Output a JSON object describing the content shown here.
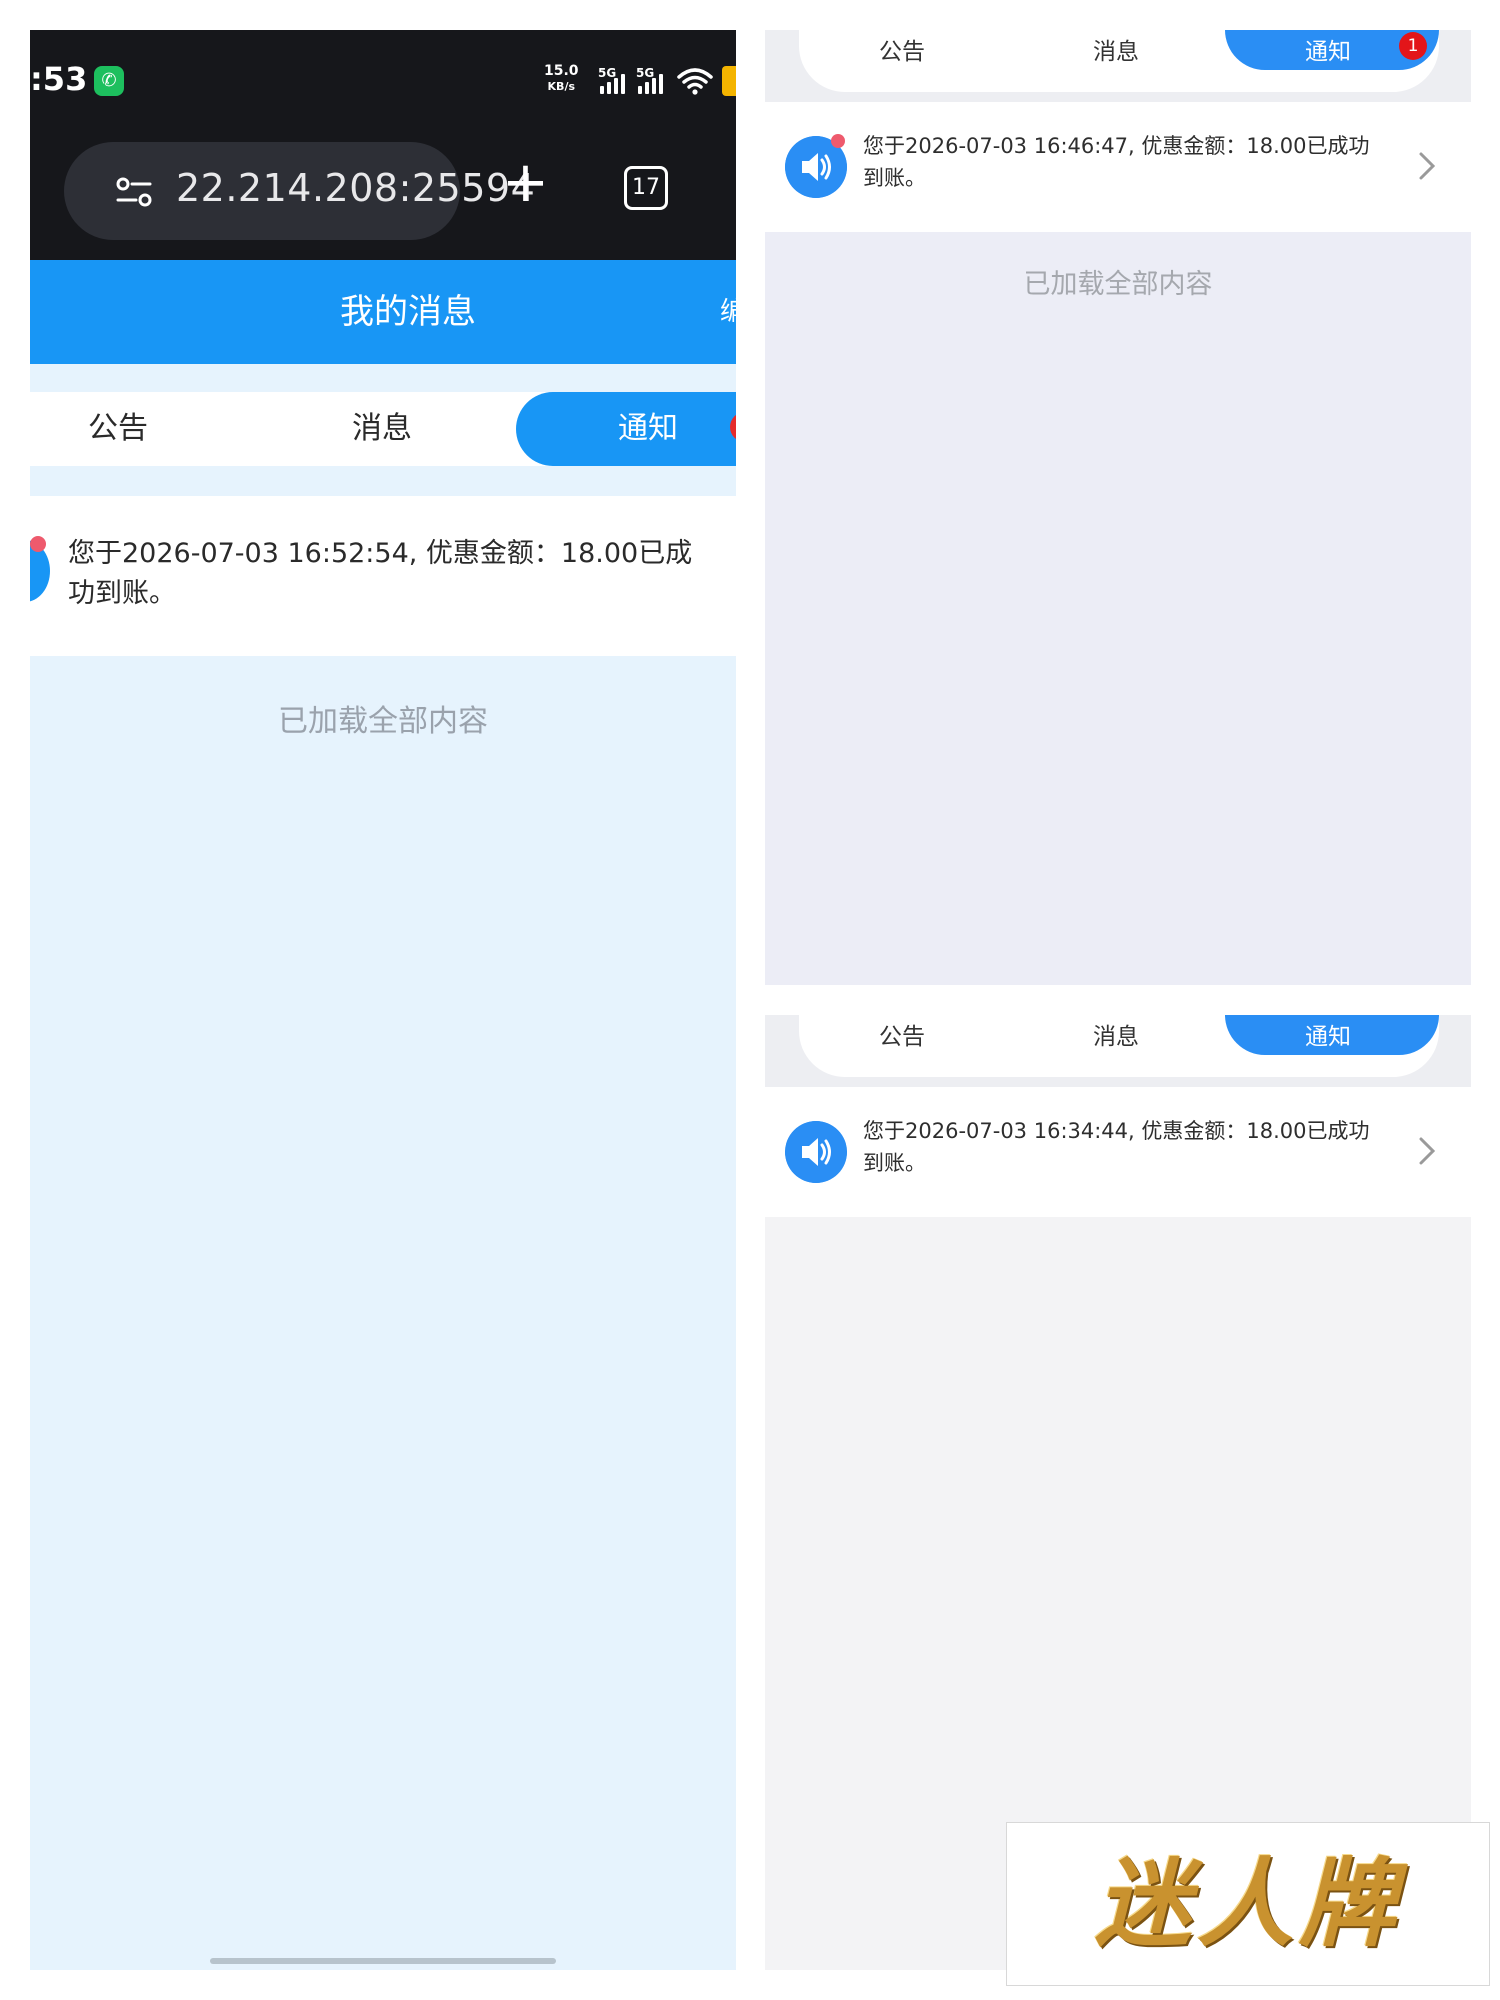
{
  "left": {
    "status": {
      "time": ":53",
      "speed_value": "15.0",
      "speed_unit": "KB/s",
      "sim1": "5G",
      "sim2": "5G"
    },
    "browser": {
      "url": "22.214.208:25594",
      "tab_count": "17",
      "new_tab": "+"
    },
    "appbar": {
      "title": "我的消息",
      "edit": "编"
    },
    "tabs": [
      "公告",
      "消息",
      "通知"
    ],
    "notice": {
      "text": "您于2026-07-03 16:52:54, 优惠金额：18.00已成功到账。"
    },
    "loaded": "已加载全部内容"
  },
  "right_top": {
    "tabs": [
      "公告",
      "消息",
      "通知"
    ],
    "badge": "1",
    "notice": {
      "text": "您于2026-07-03 16:46:47, 优惠金额：18.00已成功到账。"
    },
    "loaded": "已加载全部内容"
  },
  "right_bottom": {
    "tabs": [
      "公告",
      "消息",
      "通知"
    ],
    "notice": {
      "text": "您于2026-07-03 16:34:44, 优惠金额：18.00已成功到账。"
    }
  },
  "logo": {
    "text": "迷人牌"
  },
  "colors": {
    "accent": "#1896f5",
    "accent_right": "#2a8ef4",
    "badge": "#e3151a",
    "status_bar": "#16171b"
  }
}
